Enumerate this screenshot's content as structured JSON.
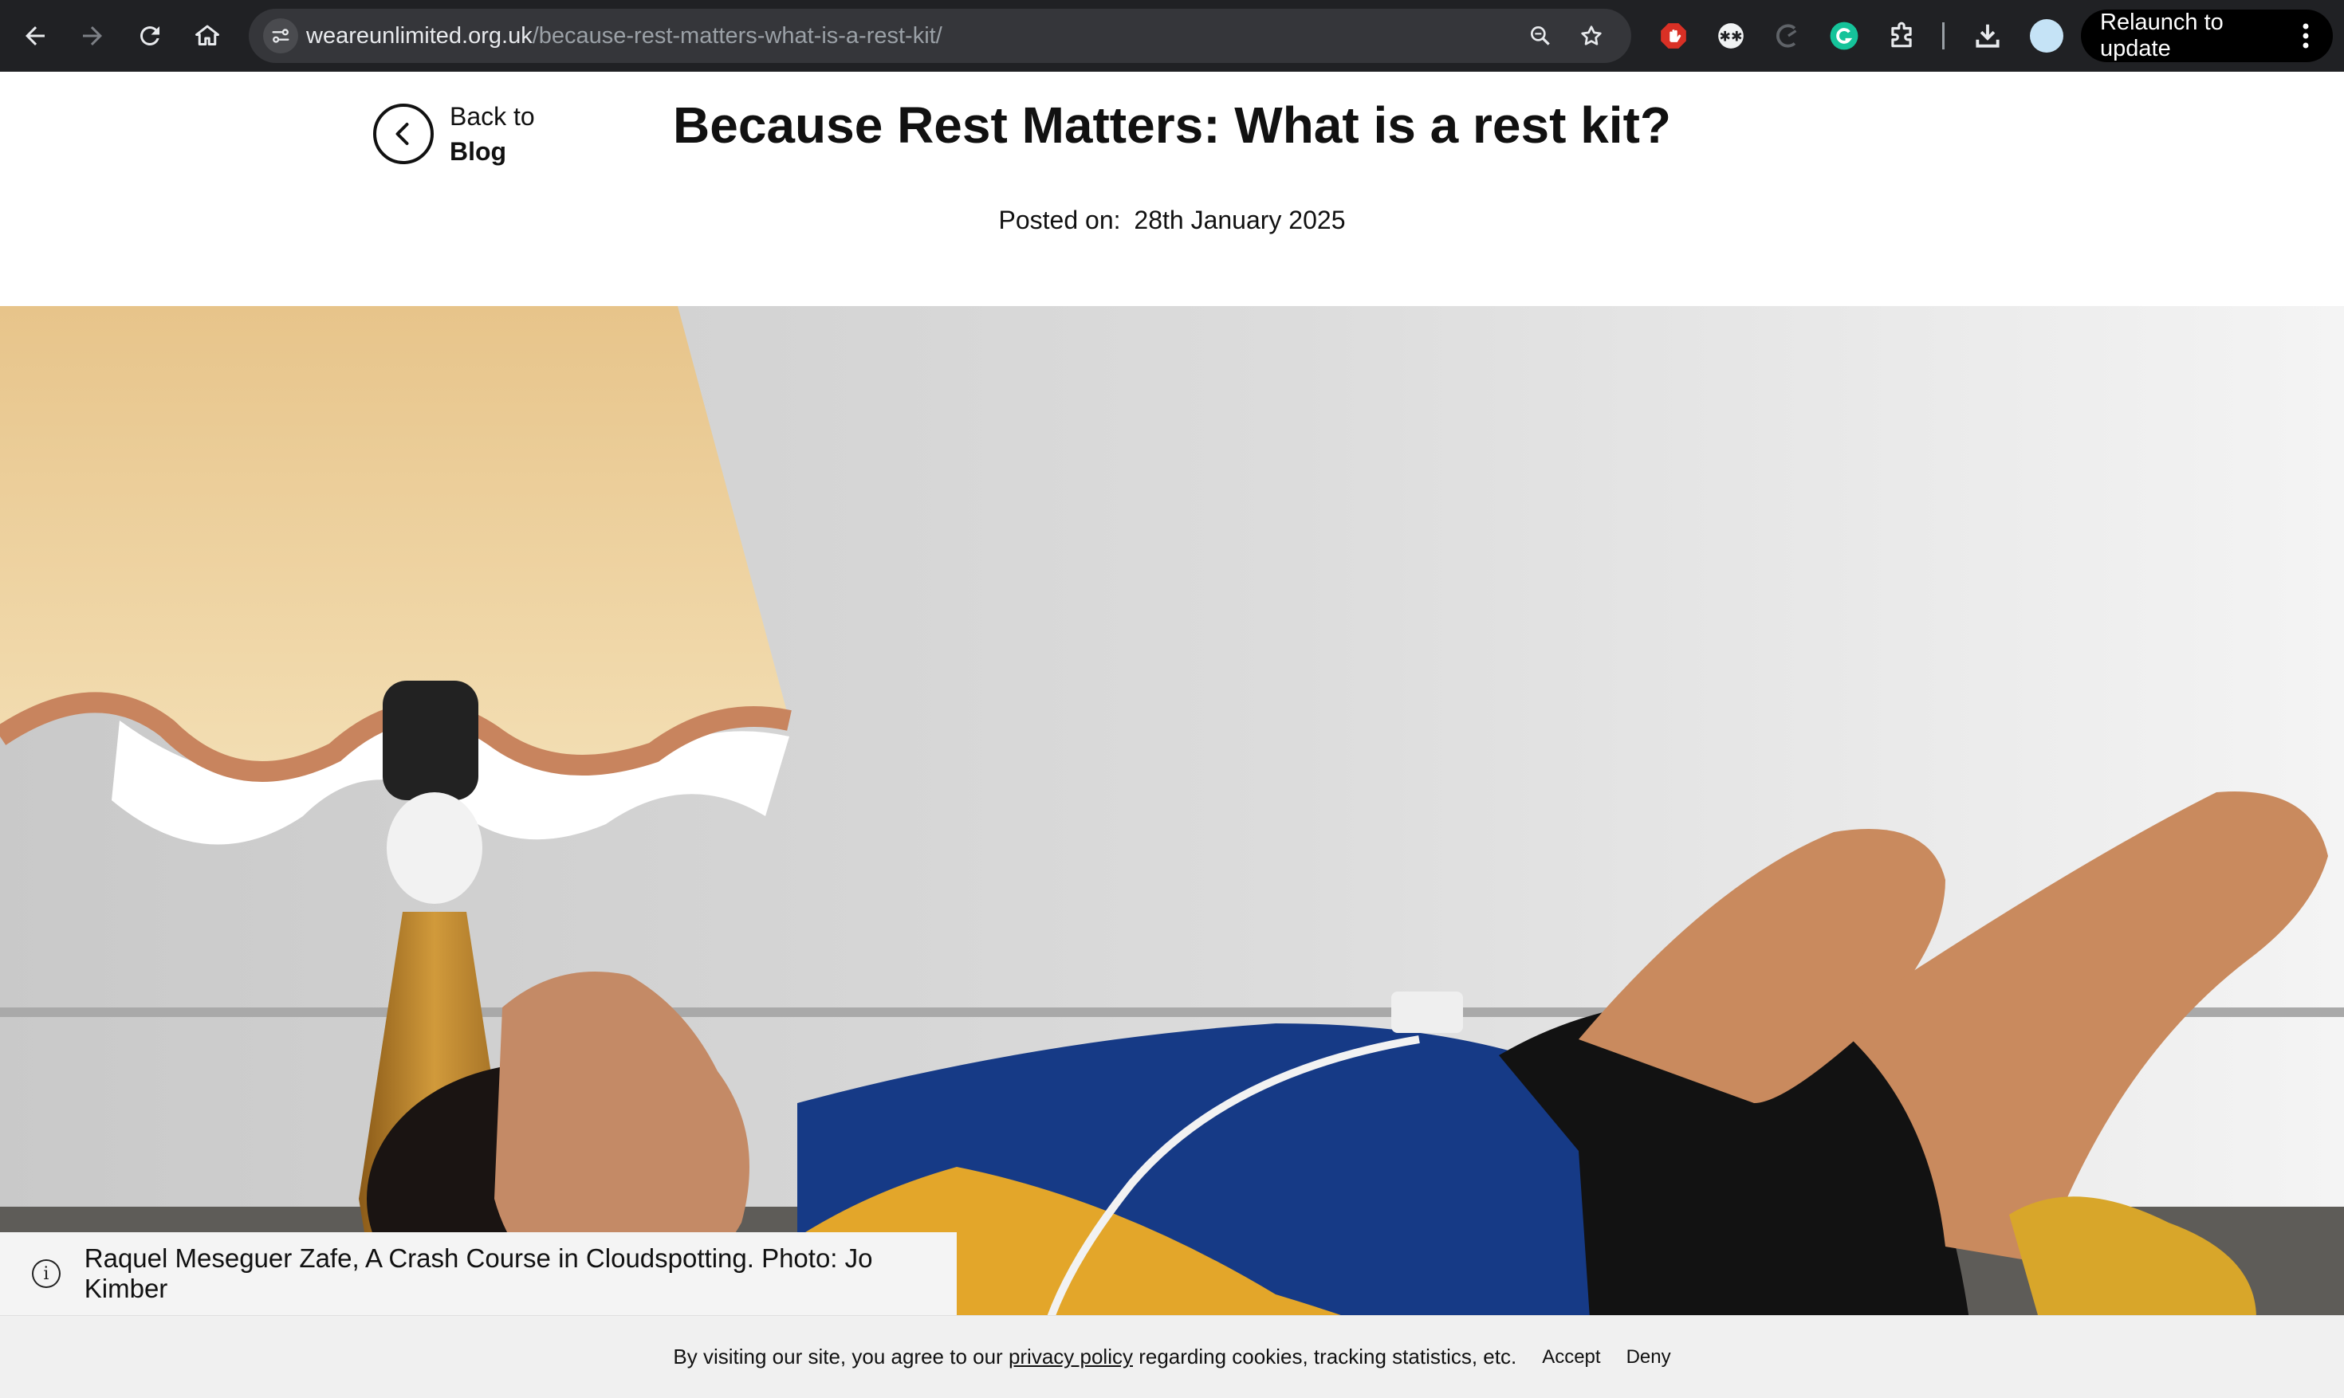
{
  "browser": {
    "url_domain": "weareunlimited.org.uk",
    "url_path": "/because-rest-matters-what-is-a-rest-kit/",
    "relaunch_label": "Relaunch to update",
    "toolbar_icons": [
      "back-icon",
      "forward-icon",
      "reload-icon",
      "home-icon",
      "site-info-icon",
      "zoom-icon",
      "bookmark-star-icon",
      "adblock-extension-icon",
      "extension-icon",
      "extension-icon-2",
      "grammarly-icon",
      "puzzle-extensions-icon",
      "download-icon",
      "profile-avatar",
      "menu-dots-icon"
    ]
  },
  "page": {
    "back_link": {
      "line1": "Back to",
      "line2": "Blog"
    },
    "title": "Because Rest Matters: What is a rest kit?",
    "posted_label": "Posted on:",
    "posted_date": "28th January 2025",
    "caption": "Raquel Meseguer Zafe, A Crash Course in Cloudspotting. Photo: Jo Kimber"
  },
  "cookie_bar": {
    "text_before": "By visiting our site, you agree to our ",
    "link_text": "privacy policy",
    "text_after": " regarding cookies, tracking statistics, etc.",
    "accept_label": "Accept",
    "deny_label": "Deny"
  },
  "colors": {
    "chrome_bg": "#202124",
    "omnibox_bg": "#35363a",
    "relaunch_bg": "#000000",
    "cookie_bg": "#f0f0f0",
    "caption_bg": "#f4f4f4"
  }
}
